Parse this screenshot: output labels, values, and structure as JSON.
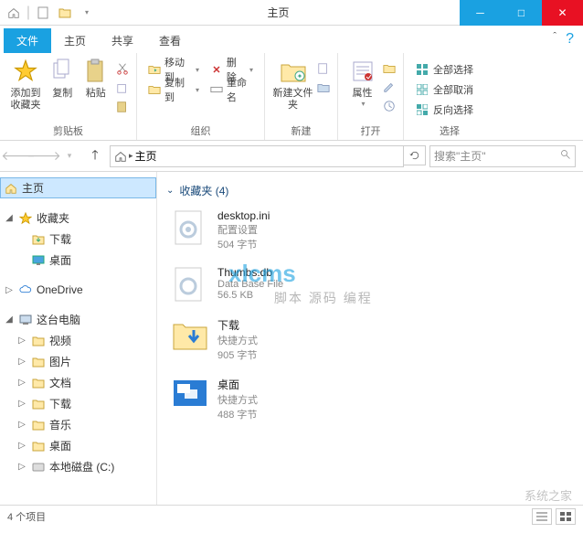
{
  "window": {
    "title": "主页"
  },
  "tabs": {
    "file": "文件",
    "home": "主页",
    "share": "共享",
    "view": "查看"
  },
  "ribbon": {
    "clipboard": {
      "label": "剪贴板",
      "pin": "添加到收藏夹",
      "copy": "复制",
      "paste": "粘贴"
    },
    "organize": {
      "label": "组织",
      "moveTo": "移动到",
      "copyTo": "复制到",
      "delete": "删除",
      "rename": "重命名"
    },
    "new": {
      "label": "新建",
      "newFolder": "新建文件夹"
    },
    "open": {
      "label": "打开",
      "properties": "属性"
    },
    "select": {
      "label": "选择",
      "selectAll": "全部选择",
      "selectNone": "全部取消",
      "invert": "反向选择"
    }
  },
  "breadcrumb": {
    "root": "主页"
  },
  "search": {
    "placeholder": "搜索\"主页\""
  },
  "tree": {
    "home": "主页",
    "favorites": "收藏夹",
    "downloads": "下载",
    "desktop": "桌面",
    "onedrive": "OneDrive",
    "thispc": "这台电脑",
    "videos": "视频",
    "pictures": "图片",
    "documents": "文档",
    "downloads2": "下载",
    "music": "音乐",
    "desktop2": "桌面",
    "localdisk": "本地磁盘 (C:)"
  },
  "group": {
    "header": "收藏夹 (4)"
  },
  "files": [
    {
      "name": "desktop.ini",
      "type": "配置设置",
      "size": "504 字节"
    },
    {
      "name": "Thumbs.db",
      "type": "Data Base File",
      "size": "56.5 KB"
    },
    {
      "name": "下载",
      "type": "快捷方式",
      "size": "905 字节"
    },
    {
      "name": "桌面",
      "type": "快捷方式",
      "size": "488 字节"
    }
  ],
  "status": {
    "count": "4 个项目"
  },
  "watermarks": {
    "w1": "xlcms",
    "w2": "脚本 源码 编程",
    "w3": "系统之家"
  }
}
